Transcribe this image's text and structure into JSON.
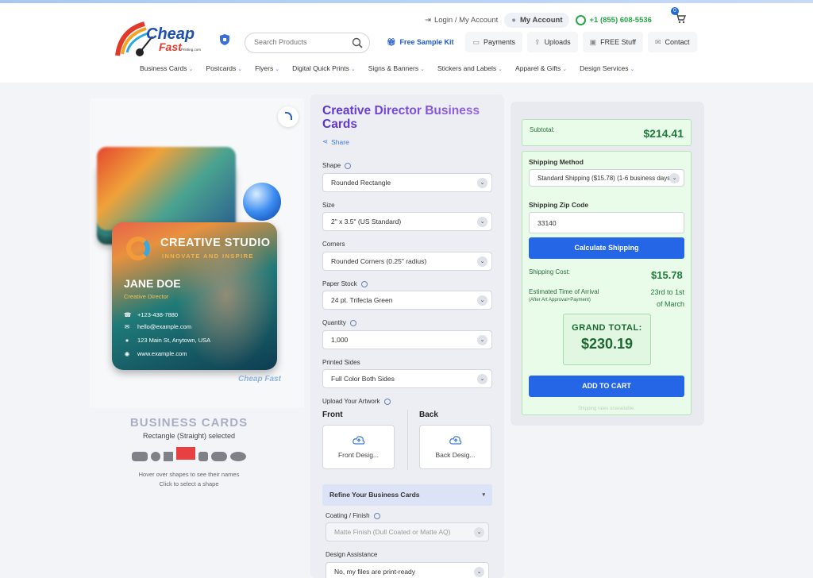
{
  "header": {
    "brand_line1": "Cheap",
    "brand_line2": "Fast",
    "brand_line3": "Printing.com",
    "login": "Login / My Account",
    "my_account": "My Account",
    "phone": "+1 (855) 608-5536",
    "cart_count": "0",
    "search_placeholder": "Search Products",
    "quicklinks": [
      "Free Sample Kit",
      "Payments",
      "Uploads",
      "FREE Stuff",
      "Contact"
    ]
  },
  "nav": {
    "categories": [
      "Business Cards",
      "Postcards",
      "Flyers",
      "Digital Quick Prints",
      "Signs & Banners",
      "Stickers and Labels",
      "Apparel & Gifts",
      "Design Services"
    ]
  },
  "preview": {
    "card_company": "CREATIVE STUDIO",
    "card_tagline": "INNOVATE AND INSPIRE",
    "card_name": "JANE DOE",
    "card_role": "Creative Director",
    "card_phone": "+123-438-7880",
    "card_email": "hello@example.com",
    "card_address": "123 Main St, Anytown, USA",
    "card_web": "www.example.com",
    "watermark": "Cheap Fast"
  },
  "shapes": {
    "title": "BUSINESS CARDS",
    "selected": "Rectangle (Straight) selected",
    "hint1": "Hover over shapes to see their names",
    "hint2": "Click to select a shape"
  },
  "product": {
    "title": "Creative Director Business Cards",
    "share": "Share",
    "options": [
      {
        "label": "Shape",
        "value": "Rounded Rectangle"
      },
      {
        "label": "Size",
        "value": "2\" x 3.5\" (US Standard)"
      },
      {
        "label": "Corners",
        "value": "Rounded Corners (0.25\" radius)"
      },
      {
        "label": "Paper Stock",
        "value": "24 pt. Trifecta Green"
      },
      {
        "label": "Quantity",
        "value": "1,000"
      },
      {
        "label": "Printed Sides",
        "value": "Full Color Both Sides"
      }
    ],
    "upload_label": "Upload Your Artwork",
    "front_label": "Front",
    "back_label": "Back",
    "front_button": "Front Desig...",
    "back_button": "Back Desig...",
    "refine": "Refine Your Business Cards",
    "coating_label": "Coating / Finish",
    "coating_value": "Matte Finish (Dull Coated or Matte AQ)",
    "design_label": "Design Assistance",
    "design_value": "No, my files are print-ready"
  },
  "summary": {
    "subtotal_label": "Subtotal:",
    "subtotal": "$214.41",
    "shipping_method_label": "Shipping Method",
    "shipping_method": "Standard Shipping ($15.78) (1-6 business days)",
    "zip_label": "Shipping Zip Code",
    "zip": "33140",
    "calc_button": "Calculate Shipping",
    "ship_cost_label": "Shipping Cost:",
    "ship_cost": "$15.78",
    "eta_label": "Estimated Time of Arrival",
    "eta_sub": "(After Art Approval+Payment)",
    "eta_line1": "23rd to 1st",
    "eta_line2": "of March",
    "grand_label": "GRAND TOTAL:",
    "grand_total": "$230.19",
    "add_to_cart": "ADD TO CART",
    "note": "Shipping rates unavailable."
  },
  "colors": {
    "accent_blue": "#2466e6",
    "title_purple": "#6a3ad8",
    "money_green": "#1e7b3a",
    "selected_shape": "#e84040"
  }
}
